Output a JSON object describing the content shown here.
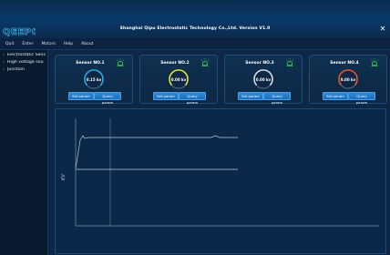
{
  "window": {
    "title": "Shanghai Qipu Electrostatic Technology Co.,Ltd. Version V1.0",
    "logo_text": "QEEPO",
    "close_symbol": "✕"
  },
  "menu": [
    "Quit",
    "Enter",
    "Motors",
    "Help",
    "About"
  ],
  "sidebar": {
    "items": [
      {
        "label": "Electrostatic Sens",
        "expanded": false
      },
      {
        "label": "High voltage sou",
        "expanded": false
      },
      {
        "label": "Junction",
        "expanded": false
      }
    ]
  },
  "sensors": [
    {
      "name": "Sensor NO.1",
      "value": "0.15 kv",
      "set_label": "Set param",
      "query_label": "Query param",
      "ring_color": "#2ea7e8"
    },
    {
      "name": "Sensor NO.2",
      "value": "0.00 kv",
      "set_label": "Set param",
      "query_label": "Query param",
      "ring_color": "#e6e33a"
    },
    {
      "name": "Sensor NO.3",
      "value": "0.00 kv",
      "set_label": "Set param",
      "query_label": "Query param",
      "ring_color": "#d8dde4"
    },
    {
      "name": "Sensor NO.4",
      "value": "0.00 kv",
      "set_label": "Set param",
      "query_label": "Query param",
      "ring_color": "#e5542d"
    }
  ],
  "colors": {
    "accent": "#2d8ad8",
    "alarm": "#3ad24a",
    "plot_line": "#b7c9dc"
  },
  "chart_data": {
    "type": "line",
    "ylabel": "KV",
    "grid": false
  }
}
